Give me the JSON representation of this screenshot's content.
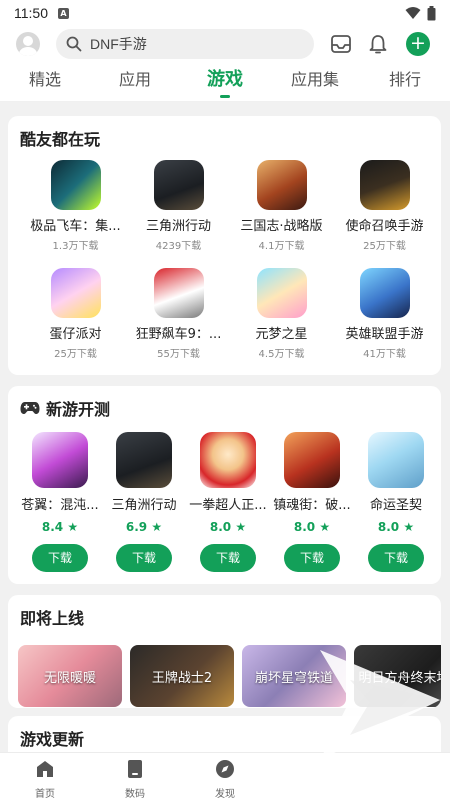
{
  "status_bar": {
    "time": "11:50",
    "indicator": "A"
  },
  "search": {
    "placeholder": "DNF手游"
  },
  "tabs": [
    {
      "label": "精选",
      "active": false
    },
    {
      "label": "应用",
      "active": false
    },
    {
      "label": "游戏",
      "active": true
    },
    {
      "label": "应用集",
      "active": false
    },
    {
      "label": "排行",
      "active": false
    }
  ],
  "kuyou": {
    "title": "酷友都在玩",
    "apps": [
      {
        "name": "极品飞车：集...",
        "downloads": "1.3万下载"
      },
      {
        "name": "三角洲行动",
        "downloads": "4239下载"
      },
      {
        "name": "三国志·战略版",
        "downloads": "4.1万下载"
      },
      {
        "name": "使命召唤手游",
        "downloads": "25万下载"
      },
      {
        "name": "蛋仔派对",
        "downloads": "25万下载"
      },
      {
        "name": "狂野飙车9：...",
        "downloads": "55万下载"
      },
      {
        "name": "元梦之星",
        "downloads": "4.5万下载"
      },
      {
        "name": "英雄联盟手游",
        "downloads": "41万下载"
      }
    ]
  },
  "new_games": {
    "title": "新游开测",
    "icon": "gamepad-icon",
    "download_label": "下载",
    "games": [
      {
        "name": "苍翼：混沌...",
        "rating": "8.4 ★"
      },
      {
        "name": "三角洲行动",
        "rating": "6.9 ★"
      },
      {
        "name": "一拳超人正...",
        "rating": "8.0 ★"
      },
      {
        "name": "镇魂街：破...",
        "rating": "8.0 ★"
      },
      {
        "name": "命运圣契",
        "rating": "8.0 ★"
      }
    ]
  },
  "coming_soon": {
    "title": "即将上线",
    "items": [
      {
        "name": "无限暖暖"
      },
      {
        "name": "王牌战士2"
      },
      {
        "name": "崩坏星穹铁道"
      },
      {
        "name": "明日方舟终末地"
      }
    ]
  },
  "game_updates": {
    "title": "游戏更新"
  },
  "bottom_nav": [
    {
      "label": "首页"
    },
    {
      "label": "数码"
    },
    {
      "label": "发现"
    }
  ],
  "colors": {
    "accent": "#13a059",
    "background": "#f1f1f1"
  }
}
